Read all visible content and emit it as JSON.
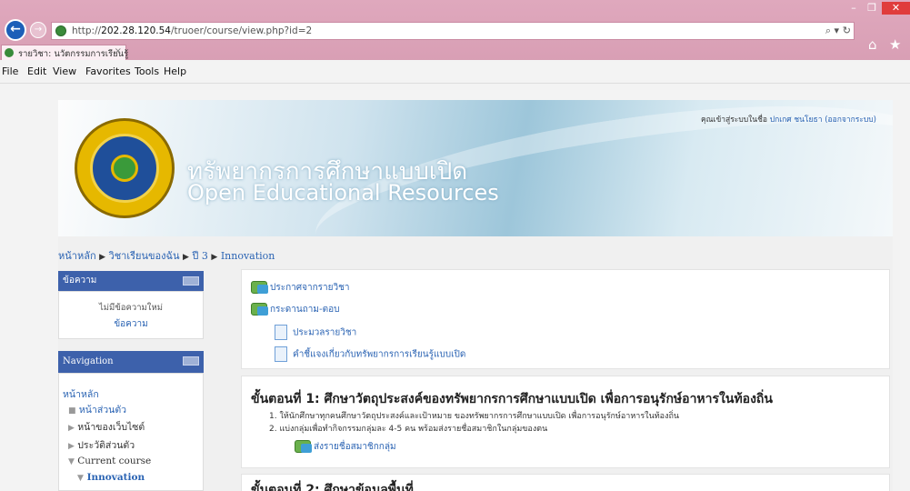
{
  "browser": {
    "url_prefix": "http://",
    "url_host": "202.28.120.54",
    "url_path": "/truoer/course/view.php?id=2",
    "tab_title": "รายวิชา: นวัตกรรมการเรียนรู้",
    "tab_close": "×",
    "menu": [
      "File",
      "Edit",
      "View",
      "Favorites",
      "Tools",
      "Help"
    ],
    "window_controls": {
      "minimize": "–",
      "maximize": "❐",
      "close": "✕"
    },
    "search_glyph": "⌕ ▾",
    "refresh_glyph": "↻"
  },
  "header": {
    "site_title_th": "ทรัพยากรการศึกษาแบบเปิด",
    "site_title_en": "Open Educational Resources",
    "login_prefix": "คุณเข้าสู่ระบบในชื่อ",
    "login_user": "ปกเกศ ชนโยธา",
    "logout_link": "(ออกจากระบบ)"
  },
  "breadcrumb": [
    "หน้าหลัก",
    "วิชาเรียนของฉัน",
    "ปี 3",
    "Innovation"
  ],
  "breadcrumb_sep": "▶",
  "blocks": {
    "messages": {
      "title": "ข้อความ",
      "no_messages": "ไม่มีข้อความใหม่",
      "link": "ข้อความ"
    },
    "navigation": {
      "title": "Navigation",
      "home": "หน้าหลัก",
      "items": [
        {
          "label": "หน้าส่วนตัว",
          "bullet": "■"
        },
        {
          "label": "หน้าของเว็บไซต์",
          "bullet": "▶"
        },
        {
          "label": "ประวัติส่วนตัว",
          "bullet": "▶"
        },
        {
          "label": "Current course",
          "bullet": "▼"
        },
        {
          "label": "Innovation",
          "bullet": "▼"
        }
      ]
    }
  },
  "course": {
    "resources": [
      {
        "label": "ประกาศจากรายวิชา",
        "icon": "forum-icon"
      },
      {
        "label": "กระดานถาม-ตอบ",
        "icon": "forum-icon"
      },
      {
        "label": "ประมวลรายวิชา",
        "icon": "page-icon"
      },
      {
        "label": "คำชี้แจงเกี่ยวกับทรัพยากรการเรียนรู้แบบเปิด",
        "icon": "page-icon"
      }
    ],
    "section1": {
      "title": "ขั้นตอนที่ 1: ศึกษาวัตถุประสงค์ของทรัพยากรการศึกษาแบบเปิด เพื่อการอนุรักษ์อาหารในท้องถิ่น",
      "lines": [
        "1. ให้นักศึกษาทุกคนศึกษาวัตถุประสงค์และเป้าหมาย ของทรัพยากรการศึกษาแบบเปิด เพื่อการอนุรักษ์อาหารในท้องถิ่น",
        "2. แบ่งกลุ่มเพื่อทำกิจกรรมกลุ่มละ 4-5 คน พร้อมส่งรายชื่อสมาชิกในกลุ่มของตน"
      ],
      "activity": "ส่งรายชื่อสมาชิกกลุ่ม"
    },
    "section2": {
      "title": "ขั้นตอนที่ 2: ศึกษาข้อมูลพื้นที่"
    }
  },
  "colors": {
    "chrome": "#d69bb1",
    "block_header": "#3d61ab",
    "link": "#2a63b3"
  }
}
